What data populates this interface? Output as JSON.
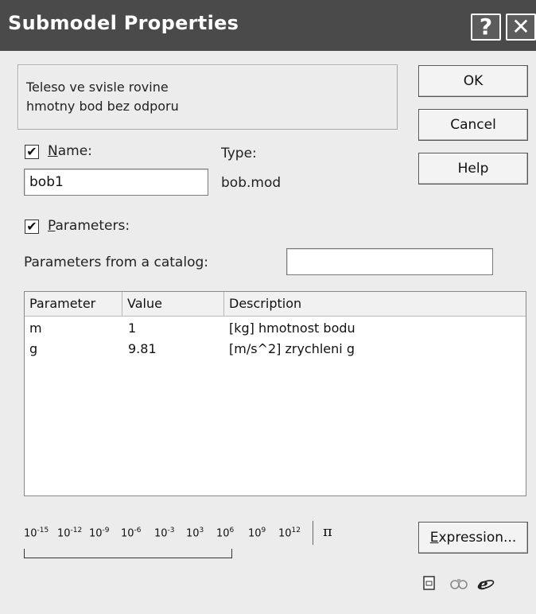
{
  "window": {
    "title": "Submodel Properties",
    "help_glyph": "?",
    "close_glyph": "✕"
  },
  "description": {
    "line1": "Teleso ve svisle rovine",
    "line2": "hmotny bod bez odporu"
  },
  "buttons": {
    "ok": "OK",
    "cancel": "Cancel",
    "help": "Help",
    "expression": "Expression..."
  },
  "name": {
    "checked": true,
    "label": "Name:",
    "value": "bob1"
  },
  "type": {
    "label": "Type:",
    "value": "bob.mod"
  },
  "parameters": {
    "checked": true,
    "label": "Parameters:",
    "catalog_label": "Parameters from a catalog:",
    "catalog_value": ""
  },
  "table": {
    "columns": [
      "Parameter",
      "Value",
      "Description"
    ],
    "rows": [
      [
        "m",
        "1",
        "[kg] hmotnost bodu"
      ],
      [
        "g",
        "9.81",
        "[m/s^2] zrychleni g"
      ]
    ]
  },
  "units": [
    "10-15",
    "10-12",
    "10-9",
    "10-6",
    "10-3",
    "103",
    "106",
    "109",
    "1012"
  ],
  "pi": "π",
  "check_glyph": "✔",
  "icons": [
    "document-icon",
    "binoculars-icon",
    "globe-icon"
  ]
}
